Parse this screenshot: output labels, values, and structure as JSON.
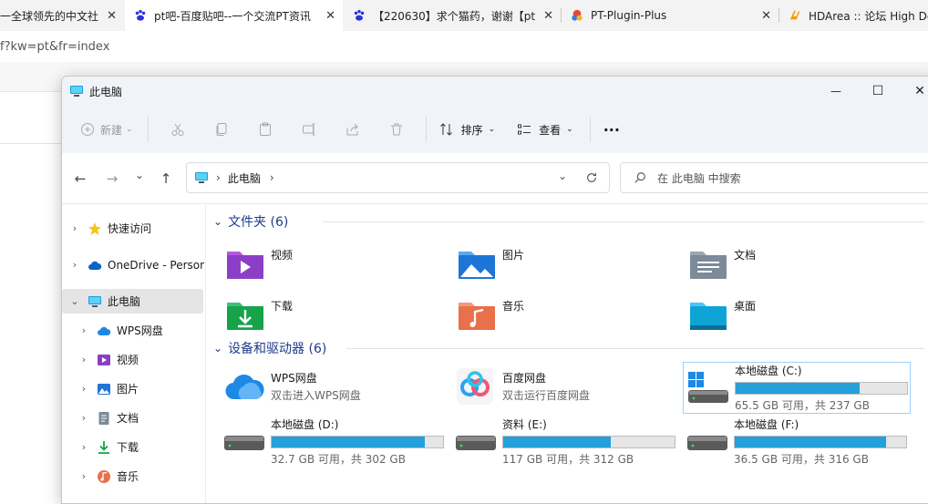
{
  "browser": {
    "tabs": [
      {
        "title": "一全球领先的中文社区",
        "active": false
      },
      {
        "title": "pt吧-百度贴吧--一个交流PT资讯",
        "active": true
      },
      {
        "title": "【220630】求个猫药，谢谢【pt",
        "active": false
      },
      {
        "title": "PT-Plugin-Plus",
        "active": false
      },
      {
        "title": "HDArea :: 论坛 High Def",
        "active": false
      }
    ],
    "close_glyph": "✕",
    "address_fragment": "f?kw=pt&fr=index"
  },
  "explorer": {
    "title": "此电脑",
    "window_buttons": {
      "minimize": "—",
      "maximize": "☐",
      "close": "✕"
    },
    "toolbar": {
      "new_label": "新建",
      "sort_label": "排序",
      "view_label": "查看",
      "more_label": "···"
    },
    "nav": {
      "back": "←",
      "forward": "→",
      "recent": "⌄",
      "up": "↑"
    },
    "address": {
      "location": "此电脑",
      "separator": "›"
    },
    "search": {
      "placeholder": "在 此电脑 中搜索"
    },
    "sidebar": [
      {
        "label": "快速访问",
        "icon": "star-icon",
        "level": 0
      },
      {
        "label": "OneDrive - Persor",
        "icon": "cloud-icon",
        "level": 0
      },
      {
        "label": "此电脑",
        "icon": "computer-icon",
        "level": 0,
        "selected": true
      },
      {
        "label": "WPS网盘",
        "icon": "wps-cloud-icon",
        "level": 1
      },
      {
        "label": "视频",
        "icon": "video-icon",
        "level": 1
      },
      {
        "label": "图片",
        "icon": "picture-icon",
        "level": 1
      },
      {
        "label": "文档",
        "icon": "document-icon",
        "level": 1
      },
      {
        "label": "下载",
        "icon": "download-icon",
        "level": 1
      },
      {
        "label": "音乐",
        "icon": "music-icon",
        "level": 1
      }
    ],
    "folders_section": {
      "title": "文件夹 (6)"
    },
    "folders": [
      {
        "label": "视频",
        "icon": "video-folder-icon"
      },
      {
        "label": "图片",
        "icon": "picture-folder-icon"
      },
      {
        "label": "文档",
        "icon": "document-folder-icon"
      },
      {
        "label": "下载",
        "icon": "download-folder-icon"
      },
      {
        "label": "音乐",
        "icon": "music-folder-icon"
      },
      {
        "label": "桌面",
        "icon": "desktop-folder-icon"
      }
    ],
    "drives_section": {
      "title": "设备和驱动器 (6)"
    },
    "drives": [
      {
        "name": "WPS网盘",
        "sub": "双击进入WPS网盘",
        "icon": "wps-cloud-icon",
        "usage": null
      },
      {
        "name": "百度网盘",
        "sub": "双击运行百度网盘",
        "icon": "baidu-netdisk-icon",
        "usage": null
      },
      {
        "name": "本地磁盘 (C:)",
        "sub": "65.5 GB 可用，共 237 GB",
        "icon": "windows-drive-icon",
        "usage": 0.724
      },
      {
        "name": "本地磁盘 (D:)",
        "sub": "32.7 GB 可用，共 302 GB",
        "icon": "hard-drive-icon",
        "usage": 0.892
      },
      {
        "name": "资料 (E:)",
        "sub": "117 GB 可用，共 312 GB",
        "icon": "hard-drive-icon",
        "usage": 0.625
      },
      {
        "name": "本地磁盘 (F:)",
        "sub": "36.5 GB 可用，共 316 GB",
        "icon": "hard-drive-icon",
        "usage": 0.884
      }
    ],
    "accent": "#26a0da"
  }
}
